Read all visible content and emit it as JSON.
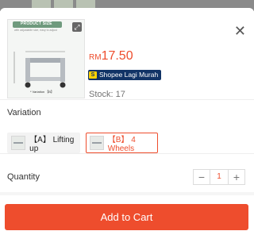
{
  "product": {
    "image_banner": "PRODUCT SIZE",
    "image_subtext": "with adjustable size, easy to adjust",
    "image_caption": "* Variation 【B】",
    "price_currency": "RM",
    "price_value": "17.50",
    "badge": "Shopee Lagi Murah",
    "badge_icon": "shopee-mall-icon",
    "stock": "Stock: 17"
  },
  "variation": {
    "title": "Variation",
    "options": [
      {
        "label": "【A】 Lifting up",
        "selected": false
      },
      {
        "label": "【B】 4 Wheels",
        "selected": true
      }
    ]
  },
  "quantity": {
    "label": "Quantity",
    "value": "1",
    "minus": "−",
    "plus": "+"
  },
  "cta": {
    "label": "Add to Cart"
  },
  "close": {
    "glyph": "✕"
  },
  "colors": {
    "accent": "#ee4d2d",
    "badge_bg": "#113366"
  }
}
